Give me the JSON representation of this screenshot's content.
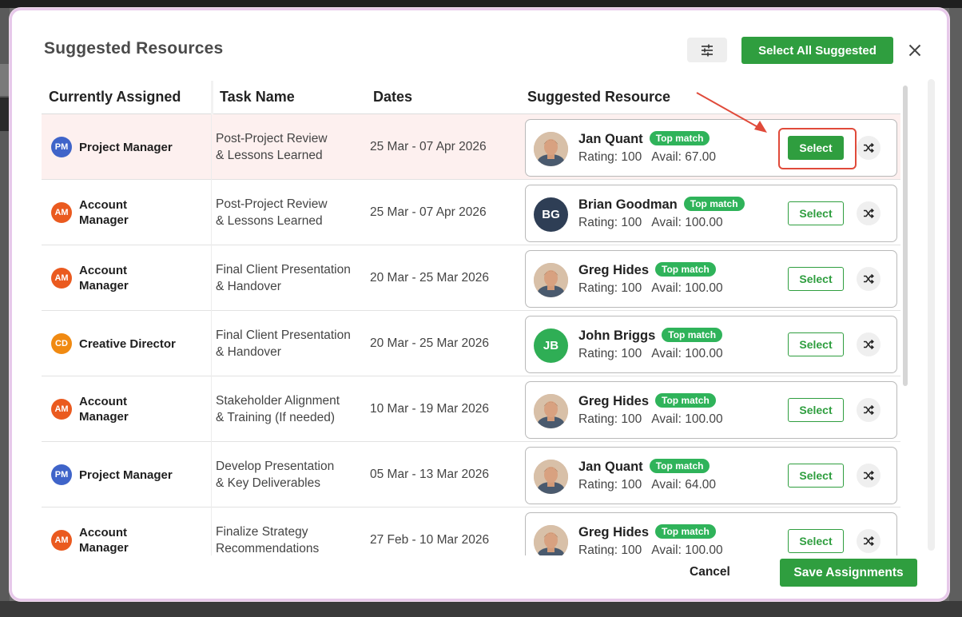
{
  "modal": {
    "title": "Suggested Resources",
    "select_all_label": "Select All Suggested",
    "cancel_label": "Cancel",
    "save_label": "Save Assignments"
  },
  "table": {
    "headers": [
      "Currently Assigned",
      "Task Name",
      "Dates",
      "Suggested Resource"
    ],
    "rows": [
      {
        "role_abbr": "PM",
        "role_color": "#3f64c9",
        "role_line1": "Project Manager",
        "role_line2": "",
        "task_line1": "Post-Project Review",
        "task_line2": "& Lessons Learned",
        "dates": "25 Mar - 07 Apr 2026",
        "resource": "Jan Quant",
        "initials": "",
        "avatar_color": "",
        "badge": "Top match",
        "rating": "Rating: 100",
        "avail": "Avail: 67.00",
        "select_label": "Select"
      },
      {
        "role_abbr": "AM",
        "role_color": "#ea5a1f",
        "role_line1": "Account",
        "role_line2": "Manager",
        "task_line1": "Post-Project Review",
        "task_line2": "& Lessons Learned",
        "dates": "25 Mar - 07 Apr 2026",
        "resource": "Brian Goodman",
        "initials": "BG",
        "avatar_color": "#2e3e55",
        "badge": "Top match",
        "rating": "Rating: 100",
        "avail": "Avail: 100.00",
        "select_label": "Select"
      },
      {
        "role_abbr": "AM",
        "role_color": "#ea5a1f",
        "role_line1": "Account",
        "role_line2": "Manager",
        "task_line1": "Final Client Presentation",
        "task_line2": "& Handover",
        "dates": "20 Mar - 25 Mar 2026",
        "resource": "Greg Hides",
        "initials": "",
        "avatar_color": "",
        "badge": "Top match",
        "rating": "Rating: 100",
        "avail": "Avail: 100.00",
        "select_label": "Select"
      },
      {
        "role_abbr": "CD",
        "role_color": "#f08a12",
        "role_line1": "Creative Director",
        "role_line2": "",
        "task_line1": "Final Client Presentation",
        "task_line2": "& Handover",
        "dates": "20 Mar - 25 Mar 2026",
        "resource": "John Briggs",
        "initials": "JB",
        "avatar_color": "#2fae55",
        "badge": "Top match",
        "rating": "Rating: 100",
        "avail": "Avail: 100.00",
        "select_label": "Select"
      },
      {
        "role_abbr": "AM",
        "role_color": "#ea5a1f",
        "role_line1": "Account",
        "role_line2": "Manager",
        "task_line1": "Stakeholder Alignment",
        "task_line2": "& Training (If needed)",
        "dates": "10 Mar - 19 Mar 2026",
        "resource": "Greg Hides",
        "initials": "",
        "avatar_color": "",
        "badge": "Top match",
        "rating": "Rating: 100",
        "avail": "Avail: 100.00",
        "select_label": "Select"
      },
      {
        "role_abbr": "PM",
        "role_color": "#3f64c9",
        "role_line1": "Project Manager",
        "role_line2": "",
        "task_line1": "Develop Presentation",
        "task_line2": "& Key Deliverables",
        "dates": "05 Mar - 13 Mar 2026",
        "resource": "Jan Quant",
        "initials": "",
        "avatar_color": "",
        "badge": "Top match",
        "rating": "Rating: 100",
        "avail": "Avail: 64.00",
        "select_label": "Select"
      },
      {
        "role_abbr": "AM",
        "role_color": "#ea5a1f",
        "role_line1": "Account",
        "role_line2": "Manager",
        "task_line1": "Finalize Strategy",
        "task_line2": "Recommendations",
        "dates": "27 Feb - 10 Mar 2026",
        "resource": "Greg Hides",
        "initials": "",
        "avatar_color": "",
        "badge": "Top match",
        "rating": "Rating: 100",
        "avail": "Avail: 100.00",
        "select_label": "Select"
      }
    ]
  },
  "colors": {
    "accent_green": "#2f9e3f",
    "badge_green": "#2fb35a",
    "highlight_row": "#fdf0ef",
    "annotation_red": "#e04a3a"
  },
  "icons": {
    "filter": "sliders-icon",
    "close": "close-icon",
    "shuffle": "shuffle-icon"
  }
}
